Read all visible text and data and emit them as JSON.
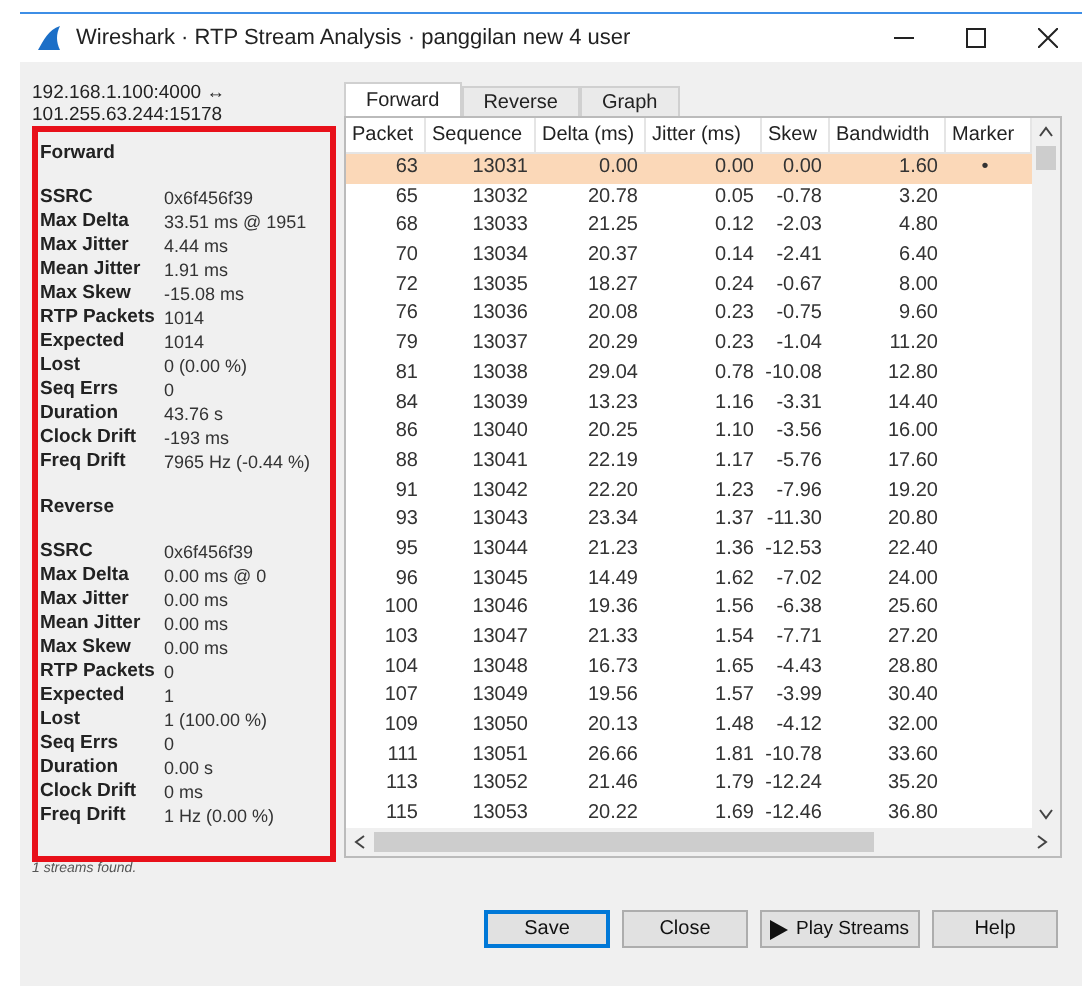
{
  "window": {
    "title": "Wireshark · RTP Stream Analysis · panggilan new 4 user"
  },
  "endpoints": [
    "192.168.1.100:4000 ↔",
    "101.255.63.244:15178"
  ],
  "sections": [
    {
      "heading": "Forward",
      "stats": [
        {
          "label": "SSRC",
          "value": "0x6f456f39"
        },
        {
          "label": "Max Delta",
          "value": "33.51 ms @ 1951"
        },
        {
          "label": "Max Jitter",
          "value": "4.44 ms"
        },
        {
          "label": "Mean Jitter",
          "value": "1.91 ms"
        },
        {
          "label": "Max Skew",
          "value": "-15.08 ms"
        },
        {
          "label": "RTP Packets",
          "value": "1014"
        },
        {
          "label": "Expected",
          "value": "1014"
        },
        {
          "label": "Lost",
          "value": "0 (0.00 %)"
        },
        {
          "label": "Seq Errs",
          "value": "0"
        },
        {
          "label": "Duration",
          "value": "43.76 s"
        },
        {
          "label": "Clock Drift",
          "value": "-193 ms"
        },
        {
          "label": "Freq Drift",
          "value": "7965 Hz (-0.44 %)"
        }
      ]
    },
    {
      "heading": "Reverse",
      "stats": [
        {
          "label": "SSRC",
          "value": "0x6f456f39"
        },
        {
          "label": "Max Delta",
          "value": "0.00 ms @ 0"
        },
        {
          "label": "Max Jitter",
          "value": "0.00 ms"
        },
        {
          "label": "Mean Jitter",
          "value": "0.00 ms"
        },
        {
          "label": "Max Skew",
          "value": "0.00 ms"
        },
        {
          "label": "RTP Packets",
          "value": "0"
        },
        {
          "label": "Expected",
          "value": "1"
        },
        {
          "label": "Lost",
          "value": "1 (100.00 %)"
        },
        {
          "label": "Seq Errs",
          "value": "0"
        },
        {
          "label": "Duration",
          "value": "0.00 s"
        },
        {
          "label": "Clock Drift",
          "value": "0 ms"
        },
        {
          "label": "Freq Drift",
          "value": "1 Hz (0.00 %)"
        }
      ]
    }
  ],
  "status": "1 streams found.",
  "tabs": [
    {
      "label": "Forward",
      "selected": true
    },
    {
      "label": "Reverse",
      "selected": false
    },
    {
      "label": "Graph",
      "selected": false
    }
  ],
  "table": {
    "columns": [
      "Packet",
      "Sequence",
      "Delta (ms)",
      "Jitter (ms)",
      "Skew",
      "Bandwidth",
      "Marker"
    ],
    "rows": [
      {
        "cells": [
          "63",
          "13031",
          "0.00",
          "0.00",
          "0.00",
          "1.60",
          "•"
        ],
        "selected": true
      },
      {
        "cells": [
          "65",
          "13032",
          "20.78",
          "0.05",
          "-0.78",
          "3.20",
          ""
        ],
        "selected": false
      },
      {
        "cells": [
          "68",
          "13033",
          "21.25",
          "0.12",
          "-2.03",
          "4.80",
          ""
        ],
        "selected": false
      },
      {
        "cells": [
          "70",
          "13034",
          "20.37",
          "0.14",
          "-2.41",
          "6.40",
          ""
        ],
        "selected": false
      },
      {
        "cells": [
          "72",
          "13035",
          "18.27",
          "0.24",
          "-0.67",
          "8.00",
          ""
        ],
        "selected": false
      },
      {
        "cells": [
          "76",
          "13036",
          "20.08",
          "0.23",
          "-0.75",
          "9.60",
          ""
        ],
        "selected": false
      },
      {
        "cells": [
          "79",
          "13037",
          "20.29",
          "0.23",
          "-1.04",
          "11.20",
          ""
        ],
        "selected": false
      },
      {
        "cells": [
          "81",
          "13038",
          "29.04",
          "0.78",
          "-10.08",
          "12.80",
          ""
        ],
        "selected": false
      },
      {
        "cells": [
          "84",
          "13039",
          "13.23",
          "1.16",
          "-3.31",
          "14.40",
          ""
        ],
        "selected": false
      },
      {
        "cells": [
          "86",
          "13040",
          "20.25",
          "1.10",
          "-3.56",
          "16.00",
          ""
        ],
        "selected": false
      },
      {
        "cells": [
          "88",
          "13041",
          "22.19",
          "1.17",
          "-5.76",
          "17.60",
          ""
        ],
        "selected": false
      },
      {
        "cells": [
          "91",
          "13042",
          "22.20",
          "1.23",
          "-7.96",
          "19.20",
          ""
        ],
        "selected": false
      },
      {
        "cells": [
          "93",
          "13043",
          "23.34",
          "1.37",
          "-11.30",
          "20.80",
          ""
        ],
        "selected": false
      },
      {
        "cells": [
          "95",
          "13044",
          "21.23",
          "1.36",
          "-12.53",
          "22.40",
          ""
        ],
        "selected": false
      },
      {
        "cells": [
          "96",
          "13045",
          "14.49",
          "1.62",
          "-7.02",
          "24.00",
          ""
        ],
        "selected": false
      },
      {
        "cells": [
          "100",
          "13046",
          "19.36",
          "1.56",
          "-6.38",
          "25.60",
          ""
        ],
        "selected": false
      },
      {
        "cells": [
          "103",
          "13047",
          "21.33",
          "1.54",
          "-7.71",
          "27.20",
          ""
        ],
        "selected": false
      },
      {
        "cells": [
          "104",
          "13048",
          "16.73",
          "1.65",
          "-4.43",
          "28.80",
          ""
        ],
        "selected": false
      },
      {
        "cells": [
          "107",
          "13049",
          "19.56",
          "1.57",
          "-3.99",
          "30.40",
          ""
        ],
        "selected": false
      },
      {
        "cells": [
          "109",
          "13050",
          "20.13",
          "1.48",
          "-4.12",
          "32.00",
          ""
        ],
        "selected": false
      },
      {
        "cells": [
          "111",
          "13051",
          "26.66",
          "1.81",
          "-10.78",
          "33.60",
          ""
        ],
        "selected": false
      },
      {
        "cells": [
          "113",
          "13052",
          "21.46",
          "1.79",
          "-12.24",
          "35.20",
          ""
        ],
        "selected": false
      },
      {
        "cells": [
          "115",
          "13053",
          "20.22",
          "1.69",
          "-12.46",
          "36.80",
          ""
        ],
        "selected": false
      }
    ]
  },
  "buttons": [
    {
      "label": "Save",
      "kind": "default"
    },
    {
      "label": "Close",
      "kind": "plain"
    },
    {
      "label": "Play Streams",
      "kind": "play"
    },
    {
      "label": "Help",
      "kind": "plain"
    }
  ]
}
